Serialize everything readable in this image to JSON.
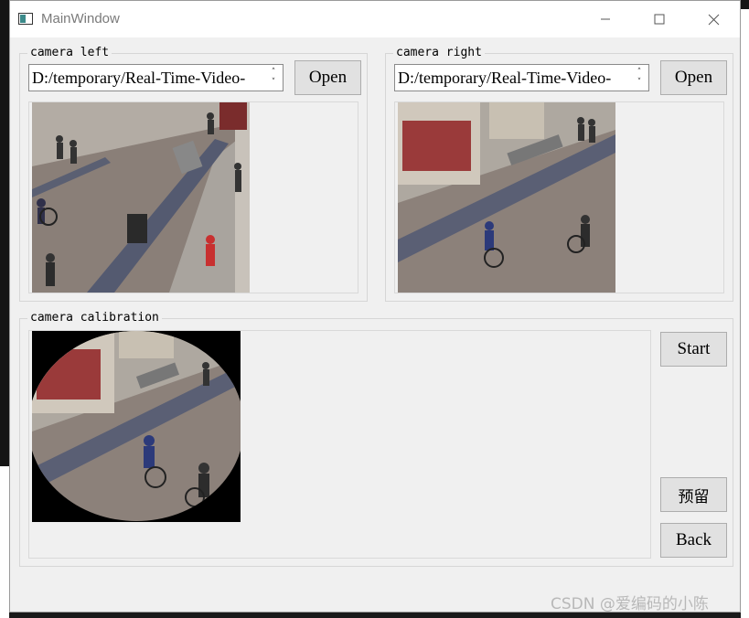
{
  "window": {
    "title": "MainWindow"
  },
  "camera_left": {
    "group_title": "camera left",
    "path": "D:/temporary/Real-Time-Video-",
    "open_label": "Open"
  },
  "camera_right": {
    "group_title": "camera right",
    "path": "D:/temporary/Real-Time-Video-",
    "open_label": "Open"
  },
  "calibration": {
    "group_title": "camera calibration",
    "start_label": "Start",
    "reserve_label": "预留",
    "back_label": "Back"
  },
  "watermark": "CSDN @爱编码的小陈",
  "icons": {
    "minimize": "minimize-icon",
    "maximize": "maximize-icon",
    "close": "close-icon",
    "spin_up": "chevron-up-icon",
    "spin_down": "chevron-down-icon"
  },
  "colors": {
    "street": "#8a7f78",
    "sidewalk": "#a9a49e",
    "mask": "#000000"
  }
}
